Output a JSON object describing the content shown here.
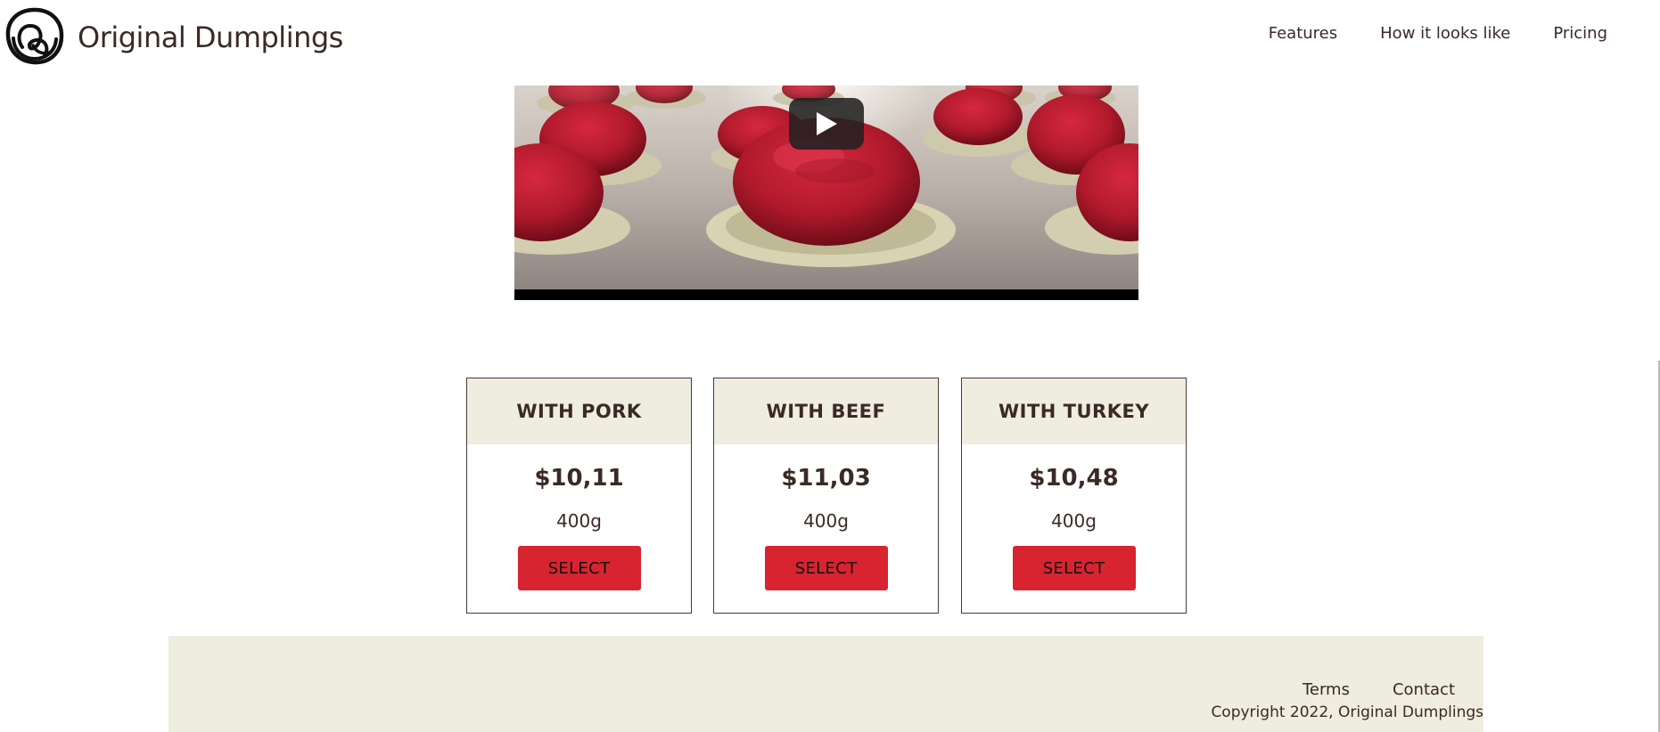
{
  "brand": {
    "name": "Original Dumplings",
    "logo_icon": "dumpling-logo-icon"
  },
  "nav": {
    "items": [
      {
        "label": "Features"
      },
      {
        "label": "How it looks like"
      },
      {
        "label": "Pricing"
      }
    ]
  },
  "video": {
    "play_icon": "play-icon",
    "description": "video thumbnail: raw meat dumpling filling on dough rounds"
  },
  "pricing": {
    "select_label": "SELECT",
    "plans": [
      {
        "name": "WITH PORK",
        "price": "$10,11",
        "weight": "400g"
      },
      {
        "name": "WITH BEEF",
        "price": "$11,03",
        "weight": "400g"
      },
      {
        "name": "WITH TURKEY",
        "price": "$10,48",
        "weight": "400g"
      }
    ]
  },
  "footer": {
    "links": [
      {
        "label": "Terms"
      },
      {
        "label": "Contact"
      }
    ],
    "copyright": "Copyright 2022, Original Dumplings"
  },
  "colors": {
    "text": "#3a2a25",
    "accent": "#d72430",
    "panel": "#efece0"
  }
}
